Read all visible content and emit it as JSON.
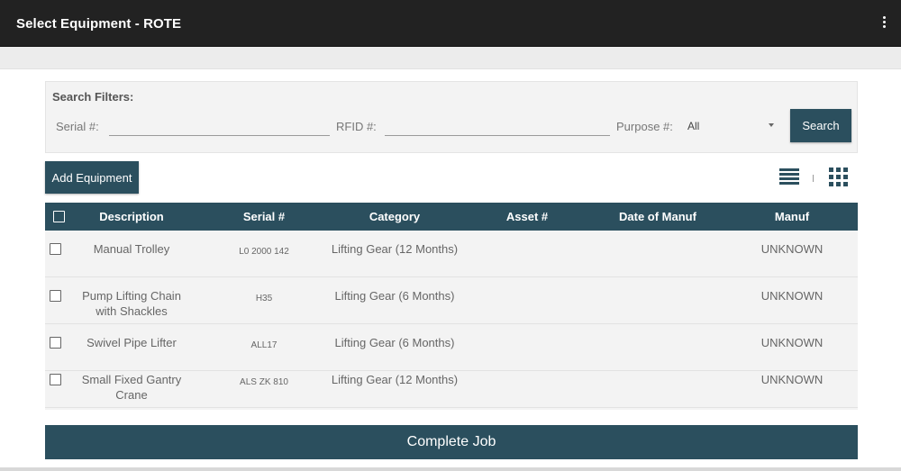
{
  "appbar": {
    "title": "Select Equipment - ROTE",
    "menu_icon": "more-vert-icon"
  },
  "filters": {
    "title": "Search Filters:",
    "serial_label": "Serial #:",
    "serial_value": "",
    "rfid_label": "RFID #:",
    "rfid_value": "",
    "purpose_label": "Purpose #:",
    "purpose_selected": "All",
    "search_label": "Search"
  },
  "toolbar": {
    "add_label": "Add Equipment",
    "list_view_icon": "list-view-icon",
    "grid_view_icon": "grid-view-icon"
  },
  "table": {
    "headers": {
      "description": "Description",
      "serial": "Serial #",
      "category": "Category",
      "asset": "Asset #",
      "date": "Date of Manuf",
      "manuf": "Manuf"
    },
    "rows": [
      {
        "description": "Manual Trolley",
        "serial": "L0 2000 142",
        "category": "Lifting Gear (12 Months)",
        "asset": "",
        "date": "",
        "manuf": "UNKNOWN"
      },
      {
        "description": "Pump Lifting Chain with Shackles",
        "serial": "H35",
        "category": "Lifting Gear (6 Months)",
        "asset": "",
        "date": "",
        "manuf": "UNKNOWN"
      },
      {
        "description": "Swivel Pipe Lifter",
        "serial": "ALL17",
        "category": "Lifting Gear (6 Months)",
        "asset": "",
        "date": "",
        "manuf": "UNKNOWN"
      },
      {
        "description": "Small Fixed Gantry Crane",
        "serial": "ALS ZK 810",
        "category": "Lifting Gear (12 Months)",
        "asset": "",
        "date": "",
        "manuf": "UNKNOWN"
      }
    ]
  },
  "footer": {
    "complete_label": "Complete Job"
  },
  "colors": {
    "primary": "#2b4f5e",
    "appbar": "#222222"
  }
}
